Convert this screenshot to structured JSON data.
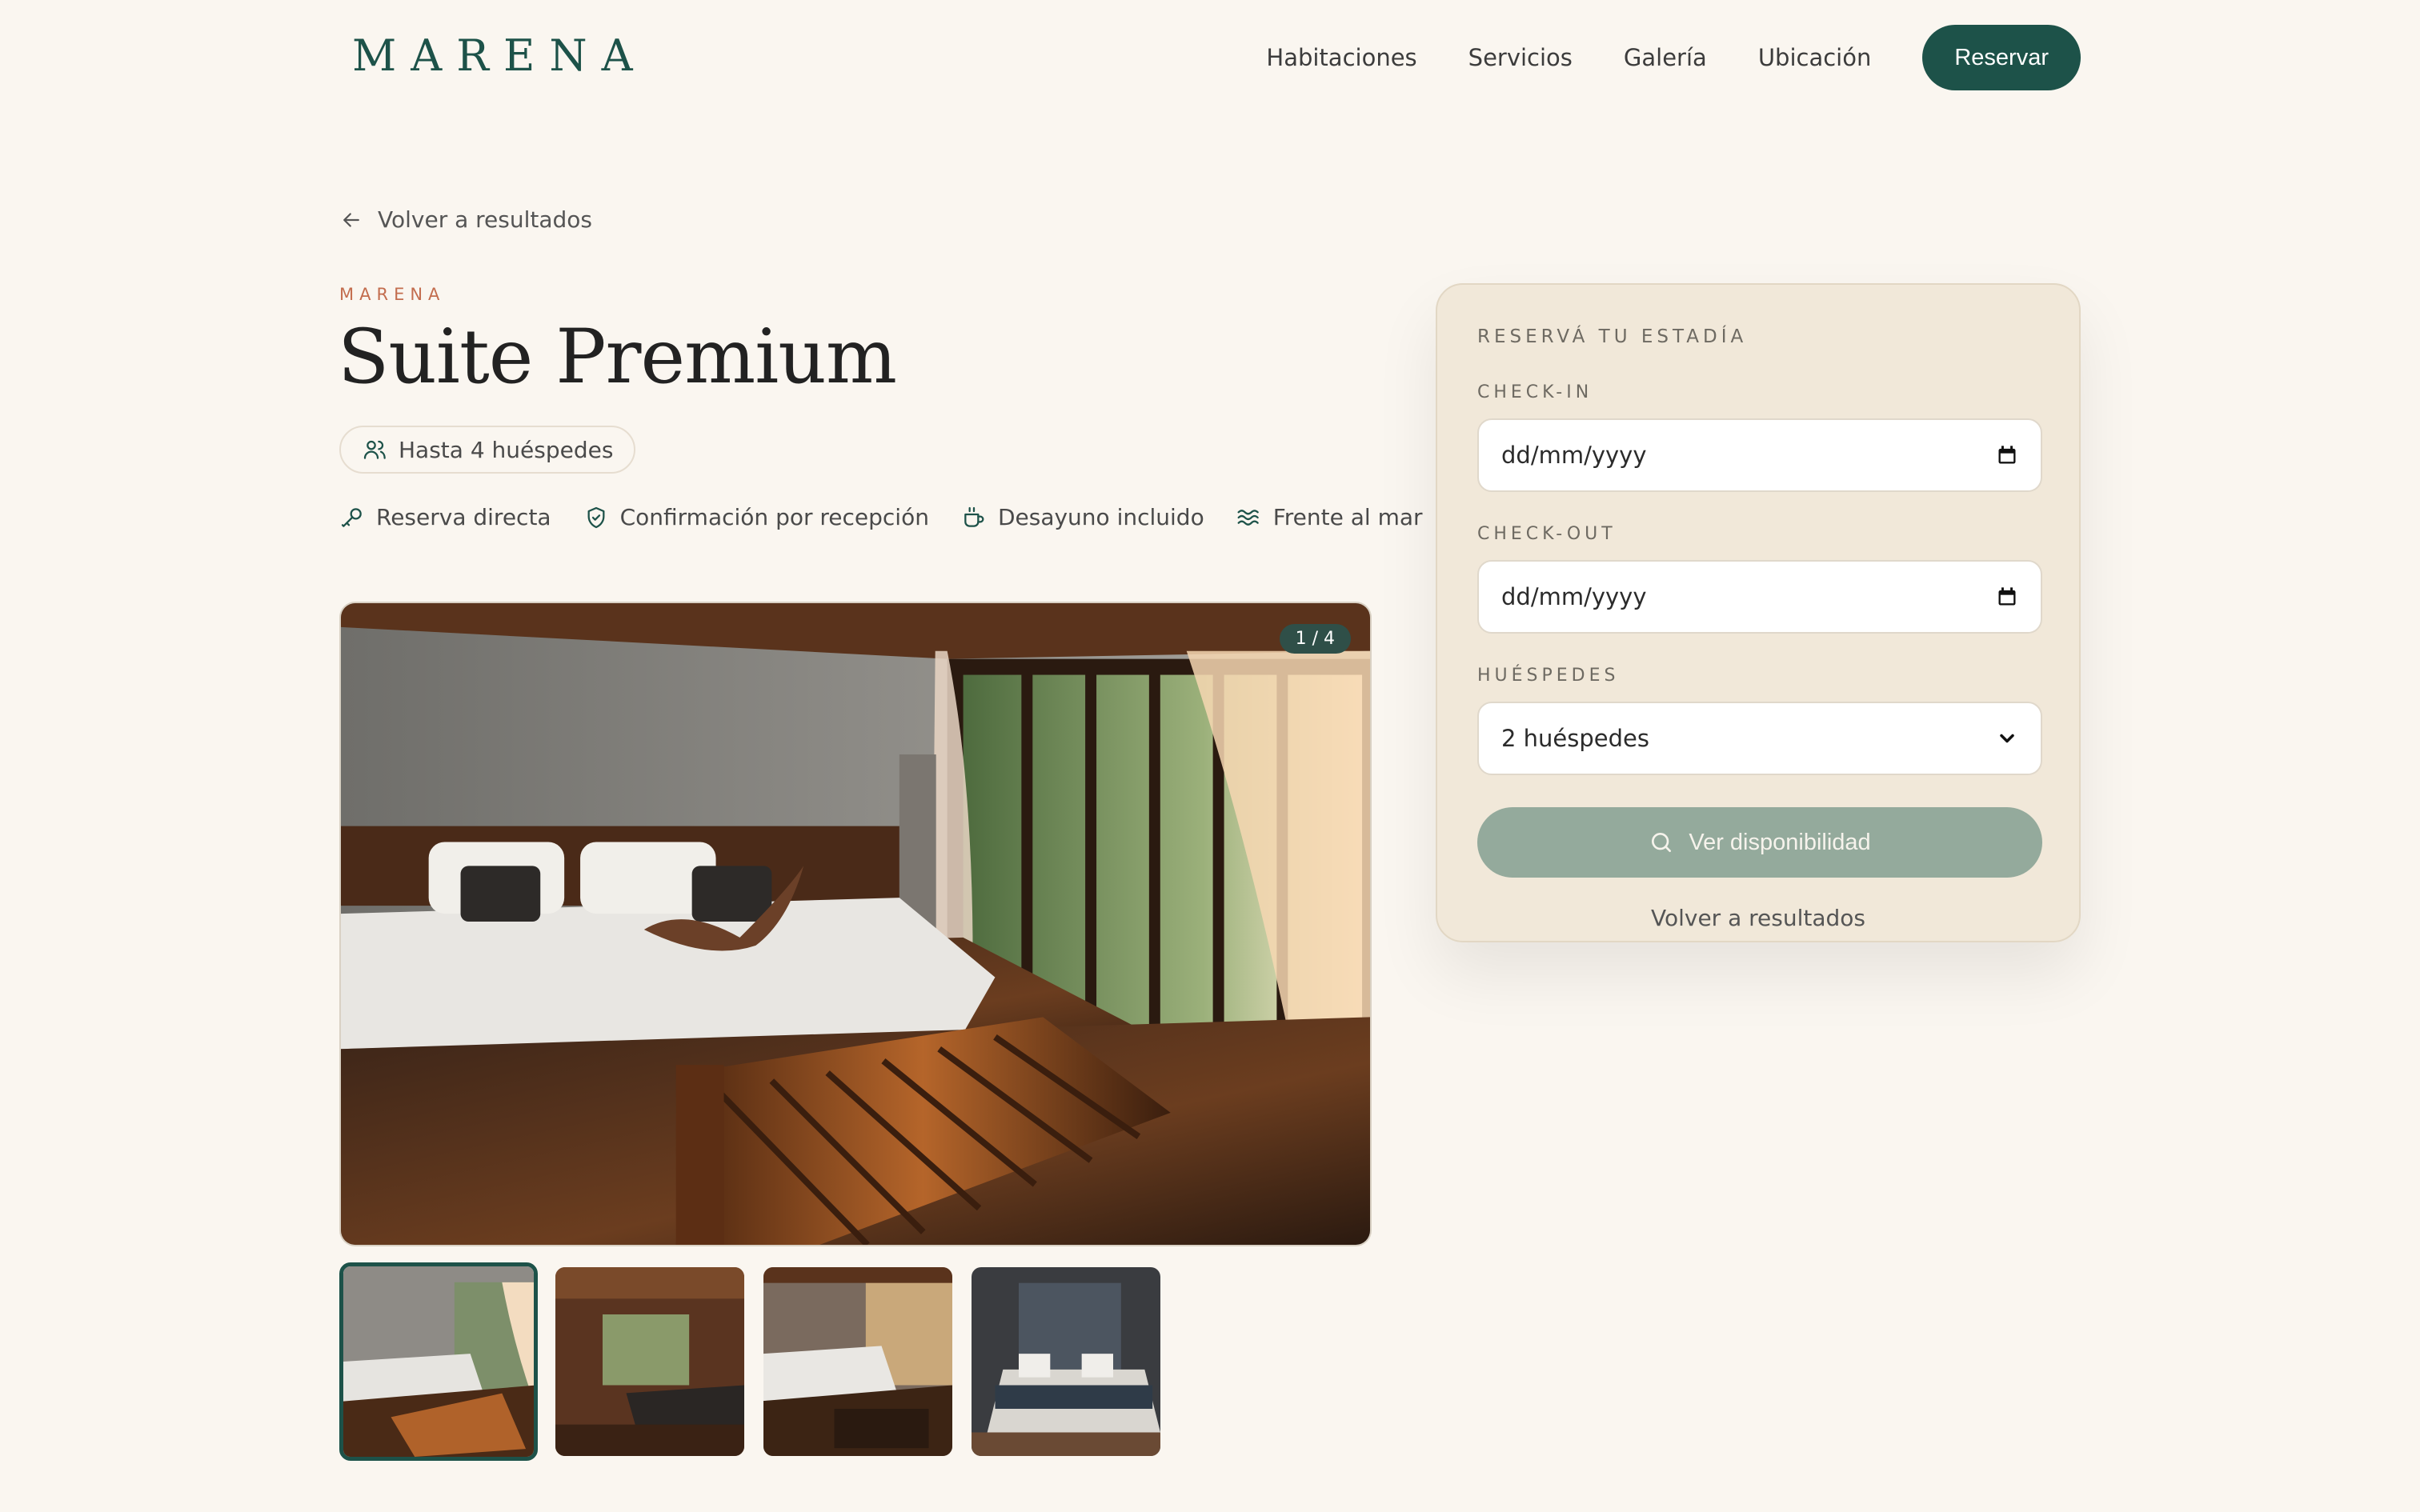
{
  "header": {
    "logo": "MARENA",
    "nav": [
      "Habitaciones",
      "Servicios",
      "Galería",
      "Ubicación"
    ],
    "cta": "Reservar"
  },
  "room": {
    "back_label": "Volver a resultados",
    "brand": "MARENA",
    "title": "Suite Premium",
    "capacity": "Hasta 4 huéspedes",
    "features": [
      "Reserva directa",
      "Confirmación por recepción",
      "Desayuno incluido",
      "Frente al mar"
    ],
    "icons": [
      "key-icon",
      "shield-check-icon",
      "coffee-icon",
      "waves-icon"
    ]
  },
  "gallery": {
    "counter": "1 / 4",
    "active_index": 0,
    "thumb_count": 4
  },
  "booking": {
    "heading": "RESERVÁ TU ESTADÍA",
    "checkin_label": "CHECK-IN",
    "checkin_value": "dd/mm/yyyy",
    "checkout_label": "CHECK-OUT",
    "checkout_value": "dd/mm/yyyy",
    "guests_label": "HUÉSPEDES",
    "guests_value": "2 huéspedes",
    "submit_label": "Ver disponibilidad",
    "back_label": "Volver a resultados"
  },
  "colors": {
    "brand": "#1d5249",
    "accent": "#c36d4e",
    "background": "#faf6f0",
    "card": "#f1e8d9",
    "button_disabled": "#94aa9c"
  }
}
